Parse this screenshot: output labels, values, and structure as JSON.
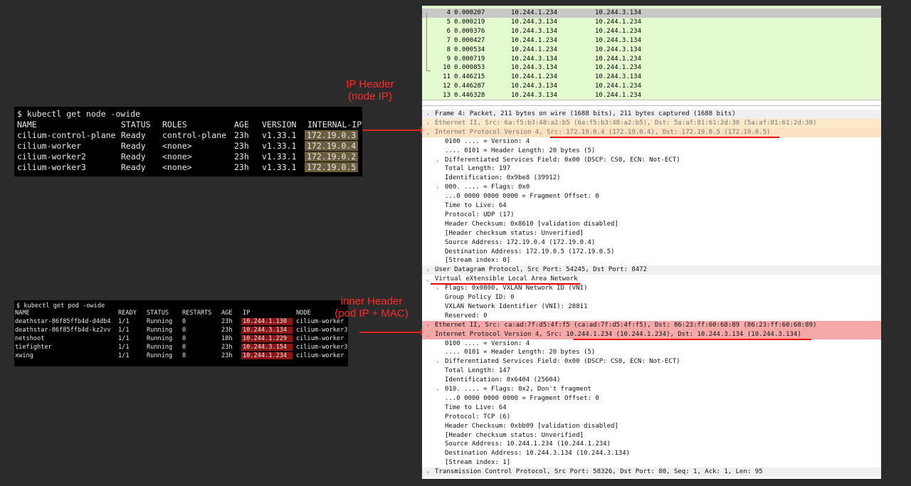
{
  "annotations": {
    "ip_header": "IP Header\n(node IP)",
    "inner_header": "inner Header\n(pod IP + MAC)"
  },
  "node_terminal": {
    "command": "$ kubectl get node -owide",
    "headers": [
      "NAME",
      "STATUS",
      "ROLES",
      "AGE",
      "VERSION",
      "INTERNAL-IP"
    ],
    "rows": [
      [
        "cilium-control-plane",
        "Ready",
        "control-plane",
        "23h",
        "v1.33.1",
        "172.19.0.3"
      ],
      [
        "cilium-worker",
        "Ready",
        "<none>",
        "23h",
        "v1.33.1",
        "172.19.0.4"
      ],
      [
        "cilium-worker2",
        "Ready",
        "<none>",
        "23h",
        "v1.33.1",
        "172.19.0.2"
      ],
      [
        "cilium-worker3",
        "Ready",
        "<none>",
        "23h",
        "v1.33.1",
        "172.19.0.5"
      ]
    ]
  },
  "pod_terminal": {
    "command": "$ kubectl get pod -owide",
    "headers": [
      "NAME",
      "READY",
      "STATUS",
      "RESTARTS",
      "AGE",
      "IP",
      "NODE"
    ],
    "rows": [
      [
        "deathstar-86f85ffb4d-d4db4",
        "1/1",
        "Running",
        "0",
        "23h",
        "10.244.1.130",
        "cilium-worker"
      ],
      [
        "deathstar-86f85ffb4d-kz2vv",
        "1/1",
        "Running",
        "0",
        "23h",
        "10.244.3.134",
        "cilium-worker3"
      ],
      [
        "netshoot",
        "1/1",
        "Running",
        "0",
        "18h",
        "10.244.1.229",
        "cilium-worker"
      ],
      [
        "tiefighter",
        "1/1",
        "Running",
        "0",
        "23h",
        "10.244.3.154",
        "cilium-worker3"
      ],
      [
        "xwing",
        "1/1",
        "Running",
        "0",
        "23h",
        "10.244.1.234",
        "cilium-worker"
      ]
    ]
  },
  "packet_list": [
    {
      "no": "4",
      "time": "0.000207",
      "src": "10.244.1.234",
      "dst": "10.244.3.134",
      "selected": true
    },
    {
      "no": "5",
      "time": "0.000219",
      "src": "10.244.3.134",
      "dst": "10.244.1.234"
    },
    {
      "no": "6",
      "time": "0.000376",
      "src": "10.244.3.134",
      "dst": "10.244.1.234"
    },
    {
      "no": "7",
      "time": "0.000427",
      "src": "10.244.1.234",
      "dst": "10.244.3.134"
    },
    {
      "no": "8",
      "time": "0.000534",
      "src": "10.244.1.234",
      "dst": "10.244.3.134"
    },
    {
      "no": "9",
      "time": "0.000719",
      "src": "10.244.3.134",
      "dst": "10.244.1.234"
    },
    {
      "no": "10",
      "time": "0.000853",
      "src": "10.244.3.134",
      "dst": "10.244.1.234"
    },
    {
      "no": "11",
      "time": "0.446215",
      "src": "10.244.1.234",
      "dst": "10.244.3.134"
    },
    {
      "no": "12",
      "time": "0.446287",
      "src": "10.244.3.134",
      "dst": "10.244.1.234"
    },
    {
      "no": "13",
      "time": "0.446328",
      "src": "10.244.3.134",
      "dst": "10.244.1.234"
    }
  ],
  "details": [
    {
      "t": "Frame 4: Packet, 211 bytes on wire (1688 bits), 211 bytes captured (1688 bits)",
      "style": "sect",
      "tw": ">",
      "indent": 0
    },
    {
      "t": "Ethernet II, Src: 6a:f5:b3:48:a2:b5 (6a:f5:b3:48:a2:b5), Dst: 5a:af:81:61:2d:30 (5a:af:81:61:2d:30)",
      "style": "eth-orange",
      "tw": ">",
      "indent": 0
    },
    {
      "t": "Internet Protocol Version 4, Src: 172.19.0.4 (172.19.0.4), Dst: 172.19.0.5 (172.19.0.5)",
      "style": "ip-orange",
      "tw": "v",
      "indent": 0
    },
    {
      "t": "0100 .... = Version: 4",
      "indent": 1
    },
    {
      "t": ".... 0101 = Header Length: 20 bytes (5)",
      "indent": 1
    },
    {
      "t": "Differentiated Services Field: 0x00 (DSCP: CS0, ECN: Not-ECT)",
      "tw": ">",
      "indent": 1
    },
    {
      "t": "Total Length: 197",
      "indent": 1
    },
    {
      "t": "Identification: 0x9be8 (39912)",
      "indent": 1
    },
    {
      "t": "000. .... = Flags: 0x0",
      "tw": ">",
      "indent": 1
    },
    {
      "t": "...0 0000 0000 0000 = Fragment Offset: 0",
      "indent": 1
    },
    {
      "t": "Time to Live: 64",
      "indent": 1
    },
    {
      "t": "Protocol: UDP (17)",
      "indent": 1
    },
    {
      "t": "Header Checksum: 0x8610 [validation disabled]",
      "indent": 1
    },
    {
      "t": "[Header checksum status: Unverified]",
      "indent": 1
    },
    {
      "t": "Source Address: 172.19.0.4 (172.19.0.4)",
      "indent": 1
    },
    {
      "t": "Destination Address: 172.19.0.5 (172.19.0.5)",
      "indent": 1
    },
    {
      "t": "[Stream index: 0]",
      "indent": 1
    },
    {
      "t": "User Datagram Protocol, Src Port: 54245, Dst Port: 8472",
      "style": "sect",
      "tw": ">",
      "indent": 0
    },
    {
      "t": "Virtual eXtensible Local Area Network",
      "tw": "v",
      "indent": 0
    },
    {
      "t": "Flags: 0x0800, VXLAN Network ID (VNI)",
      "tw": ">",
      "indent": 1
    },
    {
      "t": "Group Policy ID: 0",
      "indent": 1
    },
    {
      "t": "VXLAN Network Identifier (VNI): 28811",
      "indent": 1
    },
    {
      "t": "Reserved: 0",
      "indent": 1
    },
    {
      "t": "Ethernet II, Src: ca:ad:7f:d5:4f:f5 (ca:ad:7f:d5:4f:f5), Dst: 86:23:ff:60:68:89 (86:23:ff:60:68:89)",
      "style": "red",
      "tw": ">",
      "indent": 0
    },
    {
      "t": "Internet Protocol Version 4, Src: 10.244.1.234 (10.244.1.234), Dst: 10.244.3.134 (10.244.3.134)",
      "style": "red",
      "tw": "v",
      "indent": 0
    },
    {
      "t": "0100 .... = Version: 4",
      "indent": 1
    },
    {
      "t": ".... 0101 = Header Length: 20 bytes (5)",
      "indent": 1
    },
    {
      "t": "Differentiated Services Field: 0x00 (DSCP: CS0, ECN: Not-ECT)",
      "tw": ">",
      "indent": 1
    },
    {
      "t": "Total Length: 147",
      "indent": 1
    },
    {
      "t": "Identification: 0x6404 (25604)",
      "indent": 1
    },
    {
      "t": "010. .... = Flags: 0x2, Don't fragment",
      "tw": ">",
      "indent": 1
    },
    {
      "t": "...0 0000 0000 0000 = Fragment Offset: 0",
      "indent": 1
    },
    {
      "t": "Time to Live: 64",
      "indent": 1
    },
    {
      "t": "Protocol: TCP (6)",
      "indent": 1
    },
    {
      "t": "Header Checksum: 0xbb09 [validation disabled]",
      "indent": 1
    },
    {
      "t": "[Header checksum status: Unverified]",
      "indent": 1
    },
    {
      "t": "Source Address: 10.244.1.234 (10.244.1.234)",
      "indent": 1
    },
    {
      "t": "Destination Address: 10.244.3.134 (10.244.3.134)",
      "indent": 1
    },
    {
      "t": "[Stream index: 1]",
      "indent": 1
    },
    {
      "t": "Transmission Control Protocol, Src Port: 58326, Dst Port: 80, Seq: 1, Ack: 1, Len: 95",
      "style": "sect",
      "tw": ">",
      "indent": 0
    }
  ]
}
